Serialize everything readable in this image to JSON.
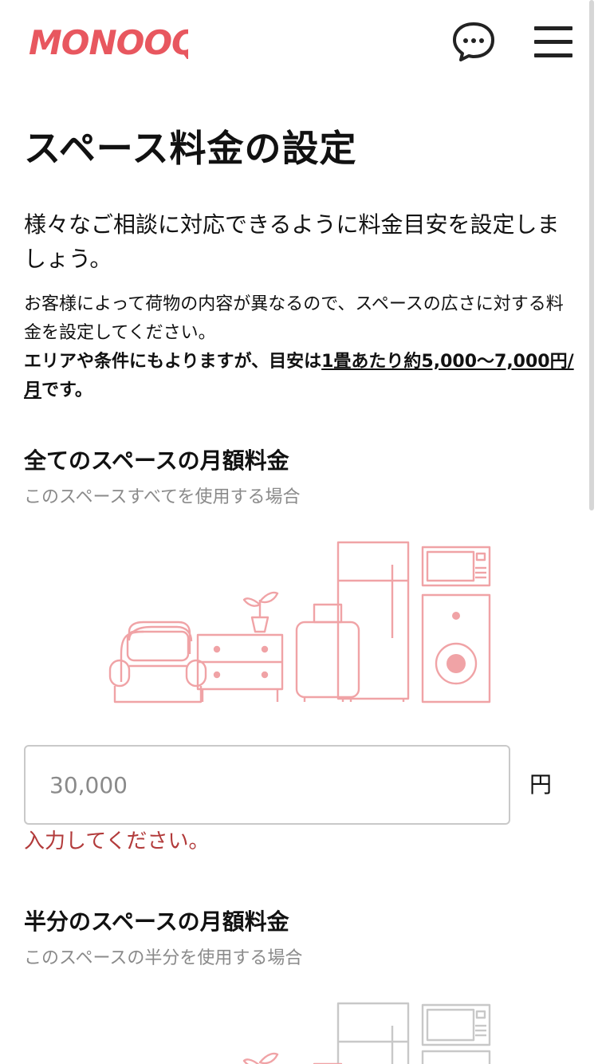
{
  "header": {
    "logo_text": "MONOOQ",
    "brand_color": "#e8575f"
  },
  "page_title": "スペース料金の設定",
  "lead": "様々なご相談に対応できるように料金目安を設定しましょう。",
  "description": "お客様によって荷物の内容が異なるので、スペースの広さに対する料金を設定してください。",
  "note": {
    "before": "エリアや条件にもよりますが、目安は",
    "underlined": "1畳あたり約5,000〜7,000円/月",
    "after": "です。"
  },
  "full_space": {
    "title": "全てのスペースの月額料金",
    "subtitle": "このスペースすべてを使用する場合",
    "input_placeholder": "30,000",
    "unit": "円",
    "error": "入力してください。",
    "illustration_color": "#f0a3a6"
  },
  "half_space": {
    "title": "半分のスペースの月額料金",
    "subtitle": "このスペースの半分を使用する場合",
    "illustration_color": "#c8c8c8"
  },
  "icons": {
    "chat": "chat-bubble-icon",
    "menu": "hamburger-menu-icon"
  }
}
